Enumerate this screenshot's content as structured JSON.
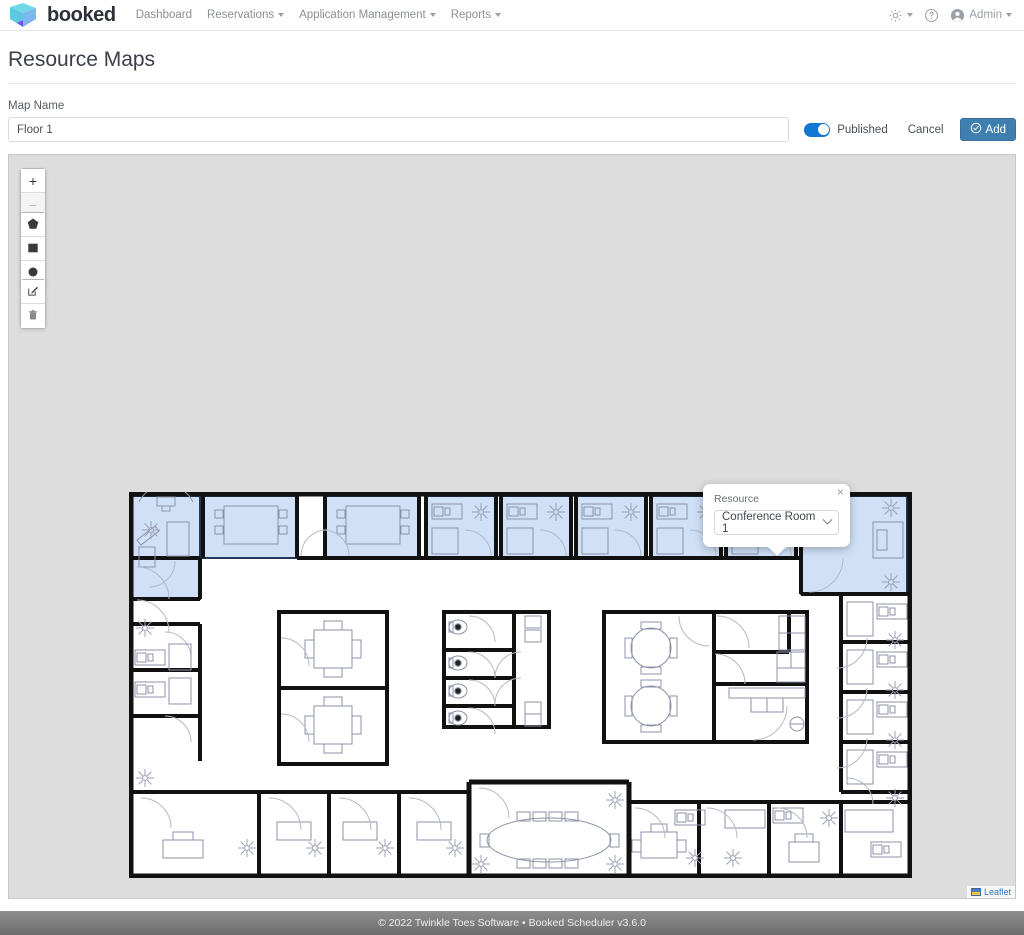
{
  "navbar": {
    "brand": "booked",
    "logo_icon": "booked-cube-logo",
    "links": [
      {
        "label": "Dashboard",
        "has_caret": false
      },
      {
        "label": "Reservations",
        "has_caret": true
      },
      {
        "label": "Application Management",
        "has_caret": true
      },
      {
        "label": "Reports",
        "has_caret": true
      }
    ],
    "right": {
      "gear_icon": "gear-icon",
      "help_icon": "help-circle-icon",
      "user_icon": "user-avatar-icon",
      "user_label": "Admin"
    }
  },
  "page": {
    "title": "Resource Maps"
  },
  "form": {
    "map_name_label": "Map Name",
    "map_name_value": "Floor 1",
    "map_name_placeholder": "Map Name",
    "published_label": "Published",
    "published_on": true,
    "cancel_label": "Cancel",
    "add_label": "Add",
    "add_icon": "check-circle-icon"
  },
  "map": {
    "background_color": "#dddddd",
    "highlight_fill": "#cfe0f7",
    "highlight_stroke": "#23395b",
    "controls": {
      "zoom_in": "+",
      "zoom_out": "−",
      "draw_polygon_icon": "polygon-icon",
      "draw_rectangle_icon": "rectangle-icon",
      "draw_circle_icon": "circle-icon",
      "edit_icon": "edit-layers-icon",
      "delete_icon": "trash-icon"
    },
    "attribution": {
      "text": "Leaflet",
      "icon": "leaflet-flag-icon"
    }
  },
  "popup": {
    "label": "Resource",
    "selected_value": "Conference Room 1",
    "close_icon": "close-icon",
    "chevron_icon": "chevron-down-icon"
  },
  "footer": {
    "text": "© 2022 Twinkle Toes Software • Booked Scheduler v3.6.0"
  }
}
